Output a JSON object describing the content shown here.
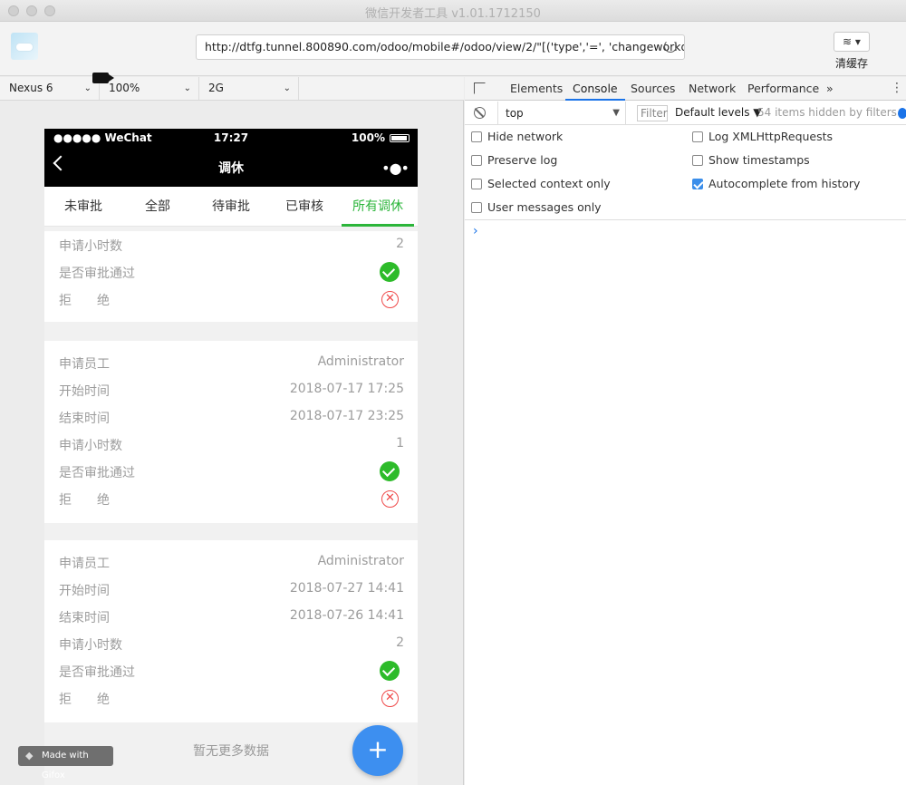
{
  "window": {
    "title": "微信开发者工具 v1.01.1712150"
  },
  "toolbar": {
    "url": "http://dtfg.tunnel.800890.com/odoo/mobile#/odoo/view/2/\"[('type','=', 'changeworkday'",
    "layers_label": "≋ ▾",
    "clear_cache_label": "清缓存"
  },
  "device_bar": {
    "device": "Nexus 6",
    "zoom": "100%",
    "network": "2G"
  },
  "phone": {
    "status": {
      "signal": "●●●●● WeChat",
      "time": "17:27",
      "battery": "100%"
    },
    "nav_title": "调休",
    "nav_more": "•●•",
    "tabs": [
      "未审批",
      "全部",
      "待审批",
      "已审核",
      "所有调休"
    ],
    "active_tab": 4,
    "cards": [
      {
        "rows": [
          {
            "label": "申请小时数",
            "value": "2"
          },
          {
            "label": "是否审批通过",
            "icon": "check-circle-icon"
          },
          {
            "label": "拒　　绝",
            "icon": "reject-circle-icon"
          }
        ]
      },
      {
        "rows": [
          {
            "label": "申请员工",
            "value": "Administrator"
          },
          {
            "label": "开始时间",
            "value": "2018-07-17 17:25"
          },
          {
            "label": "结束时间",
            "value": "2018-07-17 23:25"
          },
          {
            "label": "申请小时数",
            "value": "1"
          },
          {
            "label": "是否审批通过",
            "icon": "check-circle-icon"
          },
          {
            "label": "拒　　绝",
            "icon": "reject-circle-icon"
          }
        ]
      },
      {
        "rows": [
          {
            "label": "申请员工",
            "value": "Administrator"
          },
          {
            "label": "开始时间",
            "value": "2018-07-27 14:41"
          },
          {
            "label": "结束时间",
            "value": "2018-07-26 14:41"
          },
          {
            "label": "申请小时数",
            "value": "2"
          },
          {
            "label": "是否审批通过",
            "icon": "check-circle-icon"
          },
          {
            "label": "拒　　绝",
            "icon": "reject-circle-icon"
          }
        ]
      }
    ],
    "no_more": "暂无更多数据",
    "fab_label": "+"
  },
  "watermark": "Made with Gifox",
  "devtools": {
    "tabs": [
      "Elements",
      "Console",
      "Sources",
      "Network",
      "Performance",
      "»"
    ],
    "active_tab": "Console",
    "context": "top",
    "filter_placeholder": "Filter",
    "levels": "Default levels ▼",
    "hidden": "54 items hidden by filters",
    "options": [
      {
        "label": "Hide network",
        "checked": false
      },
      {
        "label": "Log XMLHttpRequests",
        "checked": false
      },
      {
        "label": "Preserve log",
        "checked": false
      },
      {
        "label": "Show timestamps",
        "checked": false
      },
      {
        "label": "Selected context only",
        "checked": false
      },
      {
        "label": "Autocomplete from history",
        "checked": true
      },
      {
        "label": "User messages only",
        "checked": false
      }
    ],
    "prompt": "›"
  },
  "colors": {
    "accent_green": "#2bb53a",
    "fab_blue": "#3d8ff0",
    "devtools_blue": "#1a73e8",
    "reject_red": "#ef4a4a"
  }
}
